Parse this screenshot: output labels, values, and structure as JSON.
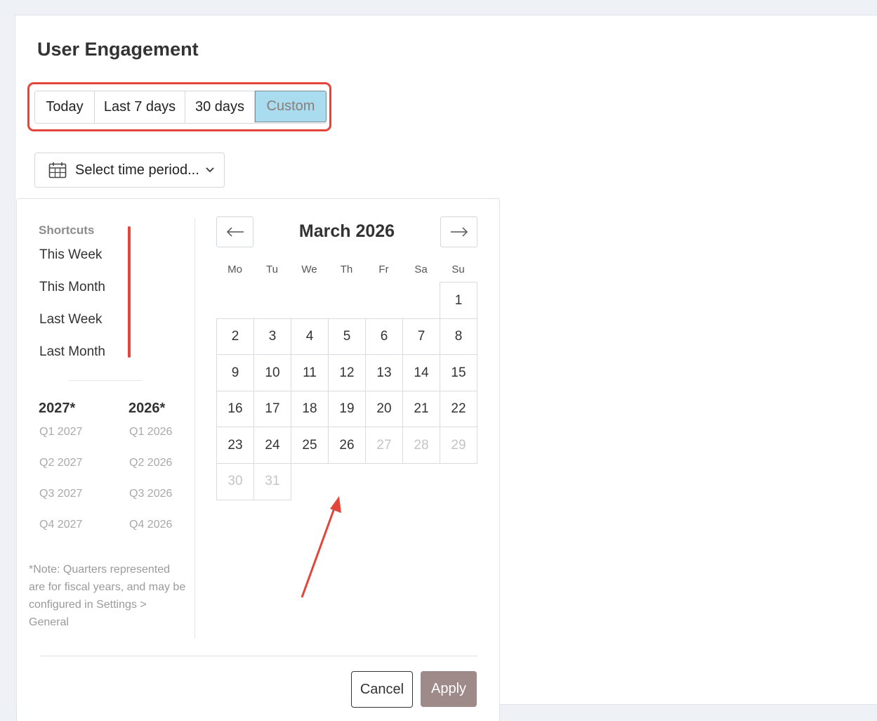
{
  "page": {
    "title": "User Engagement"
  },
  "range_tabs": [
    {
      "label": "Today",
      "selected": false
    },
    {
      "label": "Last 7 days",
      "selected": false
    },
    {
      "label": "30 days",
      "selected": false
    },
    {
      "label": "Custom",
      "selected": true
    }
  ],
  "period_select": {
    "label": "Select time period...",
    "icon": "calendar-icon",
    "caret": "chevron-down-icon"
  },
  "shortcuts": {
    "title": "Shortcuts",
    "items": [
      "This Week",
      "This Month",
      "Last Week",
      "Last Month"
    ]
  },
  "fiscal_years": [
    {
      "year": "2027*",
      "quarters": [
        "Q1 2027",
        "Q2 2027",
        "Q3 2027",
        "Q4 2027"
      ]
    },
    {
      "year": "2026*",
      "quarters": [
        "Q1 2026",
        "Q2 2026",
        "Q3 2026",
        "Q4 2026"
      ]
    }
  ],
  "note": "*Note: Quarters represented are for fiscal years, and may be configured in Settings > General",
  "calendar": {
    "month_title": "March 2026",
    "prev_icon": "arrow-left-icon",
    "next_icon": "arrow-right-icon",
    "weekdays": [
      "Mo",
      "Tu",
      "We",
      "Th",
      "Fr",
      "Sa",
      "Su"
    ],
    "first_weekday_index": 6,
    "days_in_month": 31,
    "last_enabled_day": 26
  },
  "actions": {
    "cancel": "Cancel",
    "apply": "Apply"
  },
  "colors": {
    "selected_tab_bg": "#a9dcef",
    "annotation_red": "#e2463a",
    "apply_bg": "#9e8a88"
  }
}
